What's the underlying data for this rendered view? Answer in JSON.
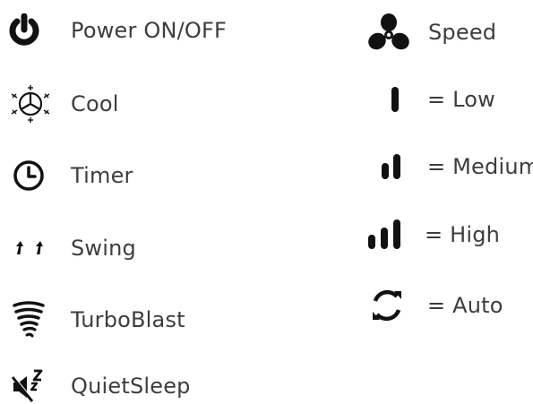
{
  "left": {
    "items": [
      {
        "icon": "power-icon",
        "label": "Power ON/OFF"
      },
      {
        "icon": "snowflake-fan-icon",
        "label": "Cool"
      },
      {
        "icon": "clock-icon",
        "label": "Timer"
      },
      {
        "icon": "swing-arrows-icon",
        "label": "Swing"
      },
      {
        "icon": "tornado-icon",
        "label": "TurboBlast"
      },
      {
        "icon": "mute-sleep-icon",
        "label": "QuietSleep"
      }
    ]
  },
  "right": {
    "speed": {
      "icon": "fan-icon",
      "label": "Speed"
    },
    "levels": [
      {
        "icon": "speed-low-icon",
        "label": "= Low"
      },
      {
        "icon": "speed-medium-icon",
        "label": "= Medium"
      },
      {
        "icon": "speed-high-icon",
        "label": "= High"
      },
      {
        "icon": "speed-auto-icon",
        "label": "= Auto"
      }
    ]
  },
  "colors": {
    "icon": "#111111",
    "text": "#3d3d3d"
  }
}
